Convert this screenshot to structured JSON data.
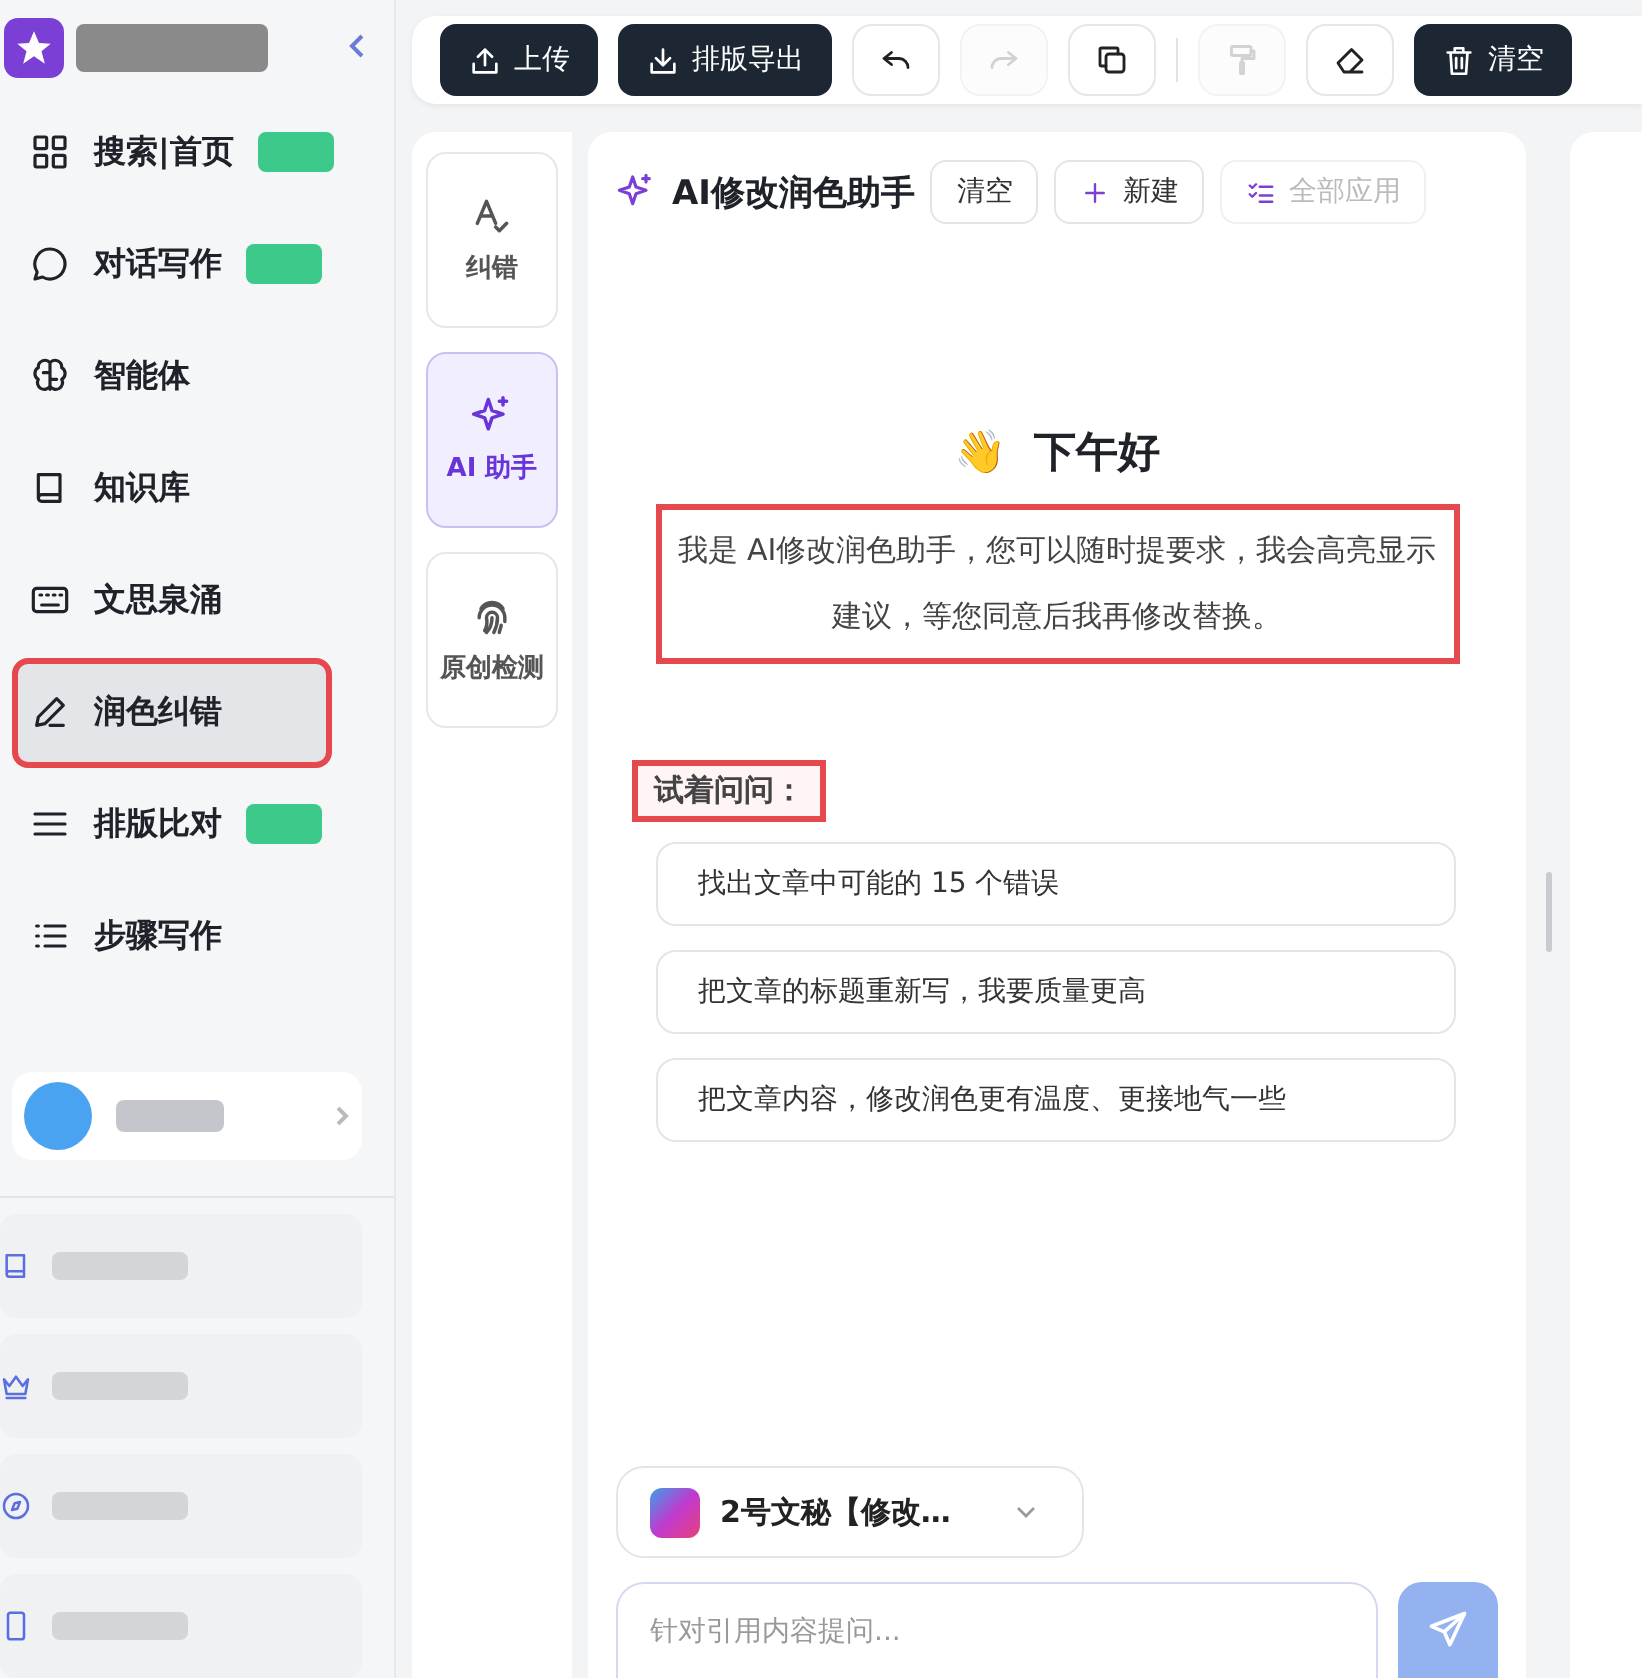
{
  "sidebar": {
    "nav": [
      {
        "label": "搜索|首页",
        "badge": true,
        "selected": false,
        "highlighted": false
      },
      {
        "label": "对话写作",
        "badge": true,
        "selected": false,
        "highlighted": false
      },
      {
        "label": "智能体",
        "badge": false,
        "selected": false,
        "highlighted": false
      },
      {
        "label": "知识库",
        "badge": false,
        "selected": false,
        "highlighted": false
      },
      {
        "label": "文思泉涌",
        "badge": false,
        "selected": false,
        "highlighted": false
      },
      {
        "label": "润色纠错",
        "badge": false,
        "selected": true,
        "highlighted": true
      },
      {
        "label": "排版比对",
        "badge": true,
        "selected": false,
        "highlighted": false
      },
      {
        "label": "步骤写作",
        "badge": false,
        "selected": false,
        "highlighted": false
      }
    ]
  },
  "toolbar": [
    {
      "kind": "dark",
      "label": "上传"
    },
    {
      "kind": "dark",
      "label": "排版导出"
    },
    {
      "kind": "icon",
      "disabled": false
    },
    {
      "kind": "icon",
      "disabled": true
    },
    {
      "kind": "icon",
      "disabled": false
    },
    {
      "kind": "divider"
    },
    {
      "kind": "icon",
      "disabled": true
    },
    {
      "kind": "icon",
      "disabled": false
    },
    {
      "kind": "dark",
      "label": "清空"
    }
  ],
  "tool_tabs": [
    {
      "label": "纠错",
      "selected": false
    },
    {
      "label": "AI 助手",
      "selected": true
    },
    {
      "label": "原创检测",
      "selected": false
    }
  ],
  "assistant": {
    "title": "AI修改润色助手",
    "actions": [
      {
        "label": "清空",
        "disabled": false
      },
      {
        "label": "新建",
        "disabled": false
      },
      {
        "label": "全部应用",
        "disabled": true
      }
    ],
    "greeting_emoji": "👋",
    "greeting": "下午好",
    "intro": "我是 AI修改润色助手，您可以随时提要求，我会高亮显示建议，等您同意后我再修改替换。",
    "intro_highlighted": true,
    "suggest_title": "试着问问：",
    "suggest_highlighted": true,
    "suggestions": [
      "找出文章中可能的 15 个错误",
      "把文章的标题重新写，我要质量更高",
      "把文章内容，修改润色更有温度、更接地气一些"
    ],
    "model": "2号文秘【修改…",
    "input_placeholder": "针对引用内容提问..."
  }
}
